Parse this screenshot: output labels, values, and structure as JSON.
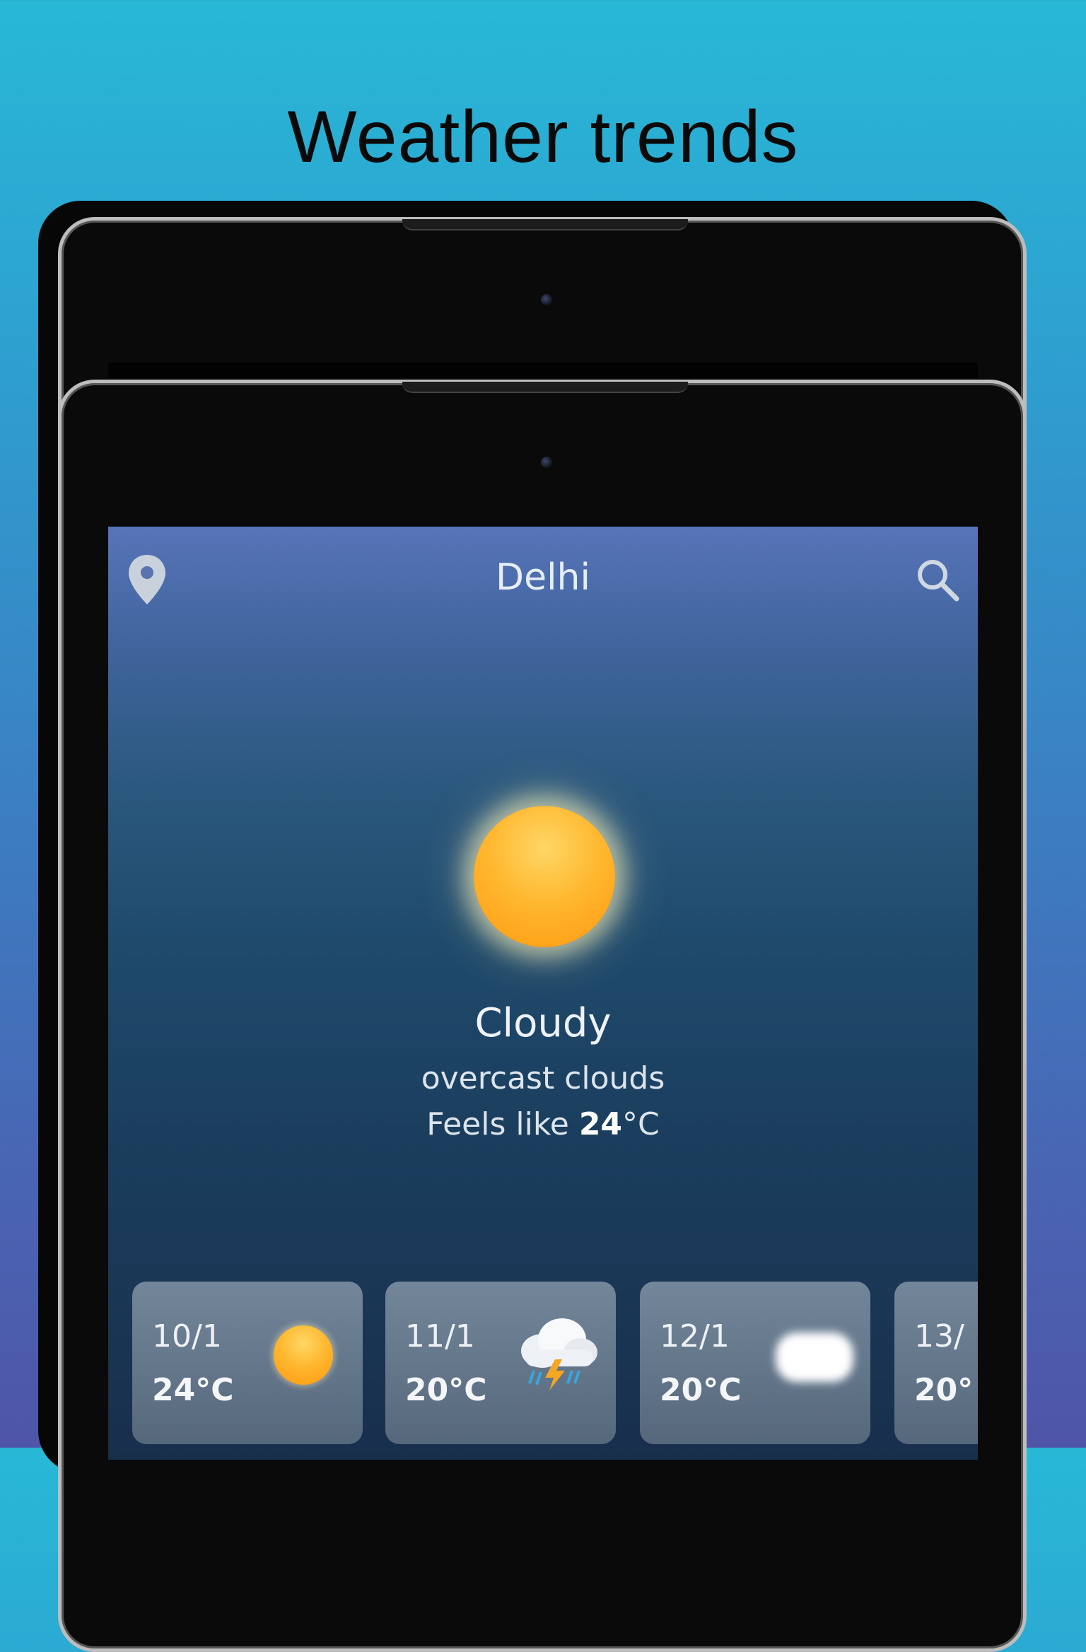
{
  "headline": "Weather trends",
  "app": {
    "city": "Delhi",
    "condition": "Cloudy",
    "description": "overcast clouds",
    "feels_like_prefix": "Feels like ",
    "feels_like_value": "24",
    "feels_like_unit": "°C"
  },
  "forecast": [
    {
      "date": "10/1",
      "temp": "24°C",
      "icon": "sun-icon"
    },
    {
      "date": "11/1",
      "temp": "20°C",
      "icon": "thunderstorm-icon"
    },
    {
      "date": "12/1",
      "temp": "20°C",
      "icon": "cloud-icon"
    },
    {
      "date": "13/",
      "temp": "20°",
      "icon": "partial-card"
    }
  ],
  "colors": {
    "background_top": "#28b8d6",
    "background_bottom": "#4f55a8",
    "sun": "#ffb830",
    "screen_top": "#5774b8",
    "screen_bottom": "#182f4c"
  }
}
